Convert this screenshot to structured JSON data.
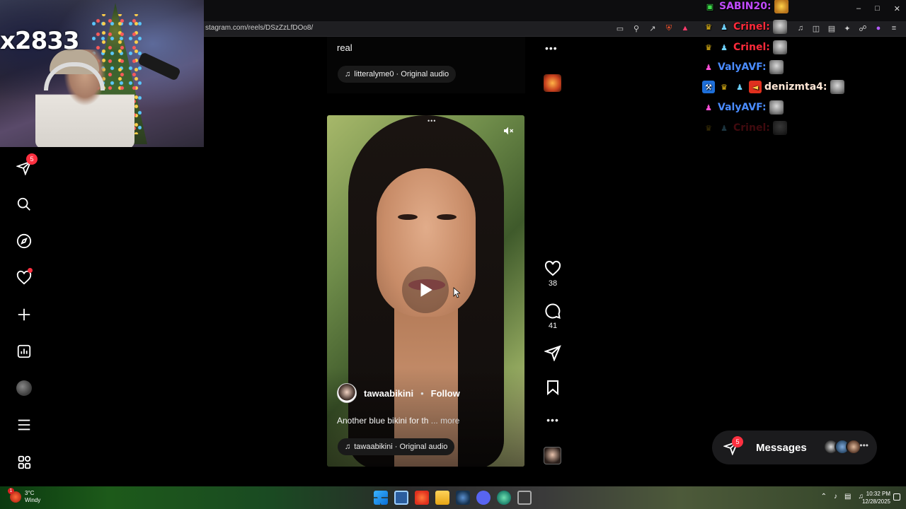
{
  "browser": {
    "url": "stagram.com/reels/DSzZzLfDOo8/"
  },
  "webcam": {
    "overlay_text": "x2833"
  },
  "sidebar": {
    "items": [
      {
        "name": "direct",
        "icon": "paper-plane-icon",
        "badge": "5"
      },
      {
        "name": "search",
        "icon": "search-icon"
      },
      {
        "name": "explore",
        "icon": "compass-icon"
      },
      {
        "name": "notifications",
        "icon": "heart-icon"
      },
      {
        "name": "create",
        "icon": "plus-icon"
      },
      {
        "name": "dashboard",
        "icon": "chart-icon"
      },
      {
        "name": "profile",
        "icon": "avatar"
      },
      {
        "name": "more",
        "icon": "menu-icon"
      },
      {
        "name": "also-from-meta",
        "icon": "apps-grid-icon"
      }
    ]
  },
  "prev_post": {
    "caption": "real",
    "audio": "litteralyme0 · Original audio"
  },
  "reel": {
    "author": "tawaabikini",
    "separator": "•",
    "follow": "Follow",
    "caption": "Another blue bikini for th",
    "caption_more": "... more",
    "audio": "tawaabikini · Original audio",
    "likes": "38",
    "comments": "41"
  },
  "chat": {
    "lines": [
      {
        "user": "SABIN20:",
        "color": "#c14bff"
      },
      {
        "user": "Crinel:",
        "color": "#ff2b3b"
      },
      {
        "user": "Crinel:",
        "color": "#ff2b3b"
      },
      {
        "user": "ValyAVF:",
        "color": "#4a8cff"
      },
      {
        "user": "denizmta4:",
        "color": "#ffe7d6"
      },
      {
        "user": "ValyAVF:",
        "color": "#4a8cff"
      },
      {
        "user": "Crinel:",
        "color": "#ff2b3b"
      }
    ]
  },
  "messages": {
    "label": "Messages",
    "badge": "5"
  },
  "taskbar": {
    "weather_temp": "3°C",
    "weather_desc": "Windy",
    "weather_badge": "1",
    "time": "10:32 PM",
    "date": "12/28/2025"
  },
  "colors": {
    "accent_red": "#ff3040",
    "background": "#000000"
  }
}
